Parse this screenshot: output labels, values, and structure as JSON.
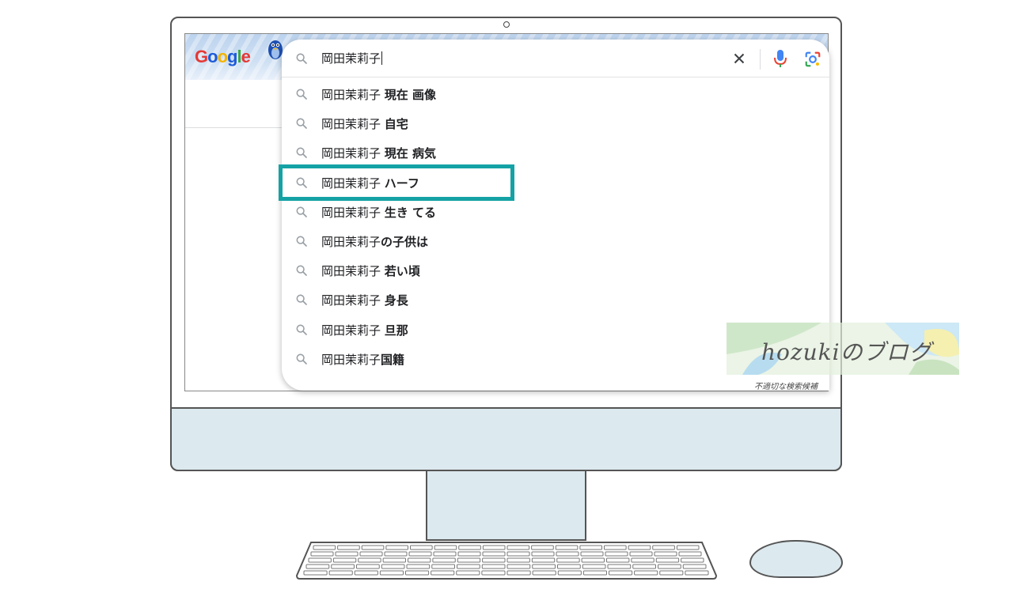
{
  "search": {
    "query": "岡田茉莉子",
    "clear_label": "×"
  },
  "suggestions": [
    {
      "prefix": "岡田茉莉子 ",
      "bold": "現在 画像"
    },
    {
      "prefix": "岡田茉莉子 ",
      "bold": "自宅"
    },
    {
      "prefix": "岡田茉莉子 ",
      "bold": "現在 病気"
    },
    {
      "prefix": "岡田茉莉子 ",
      "bold": "ハーフ"
    },
    {
      "prefix": "岡田茉莉子 ",
      "bold": "生き てる"
    },
    {
      "prefix": "岡田茉莉子",
      "bold": "の子供は"
    },
    {
      "prefix": "岡田茉莉子 ",
      "bold": "若い頃"
    },
    {
      "prefix": "岡田茉莉子 ",
      "bold": "身長"
    },
    {
      "prefix": "岡田茉莉子 ",
      "bold": "旦那"
    },
    {
      "prefix": "岡田茉莉子",
      "bold": "国籍"
    }
  ],
  "highlighted_index": 3,
  "footer_note": "不適切な検索候補",
  "logo": {
    "letters": [
      "G",
      "o",
      "o",
      "g",
      "l",
      "e"
    ]
  },
  "watermark": "hozukiのブログ",
  "colors": {
    "highlight": "#15a2a5",
    "device_fill": "#dce9ee"
  }
}
